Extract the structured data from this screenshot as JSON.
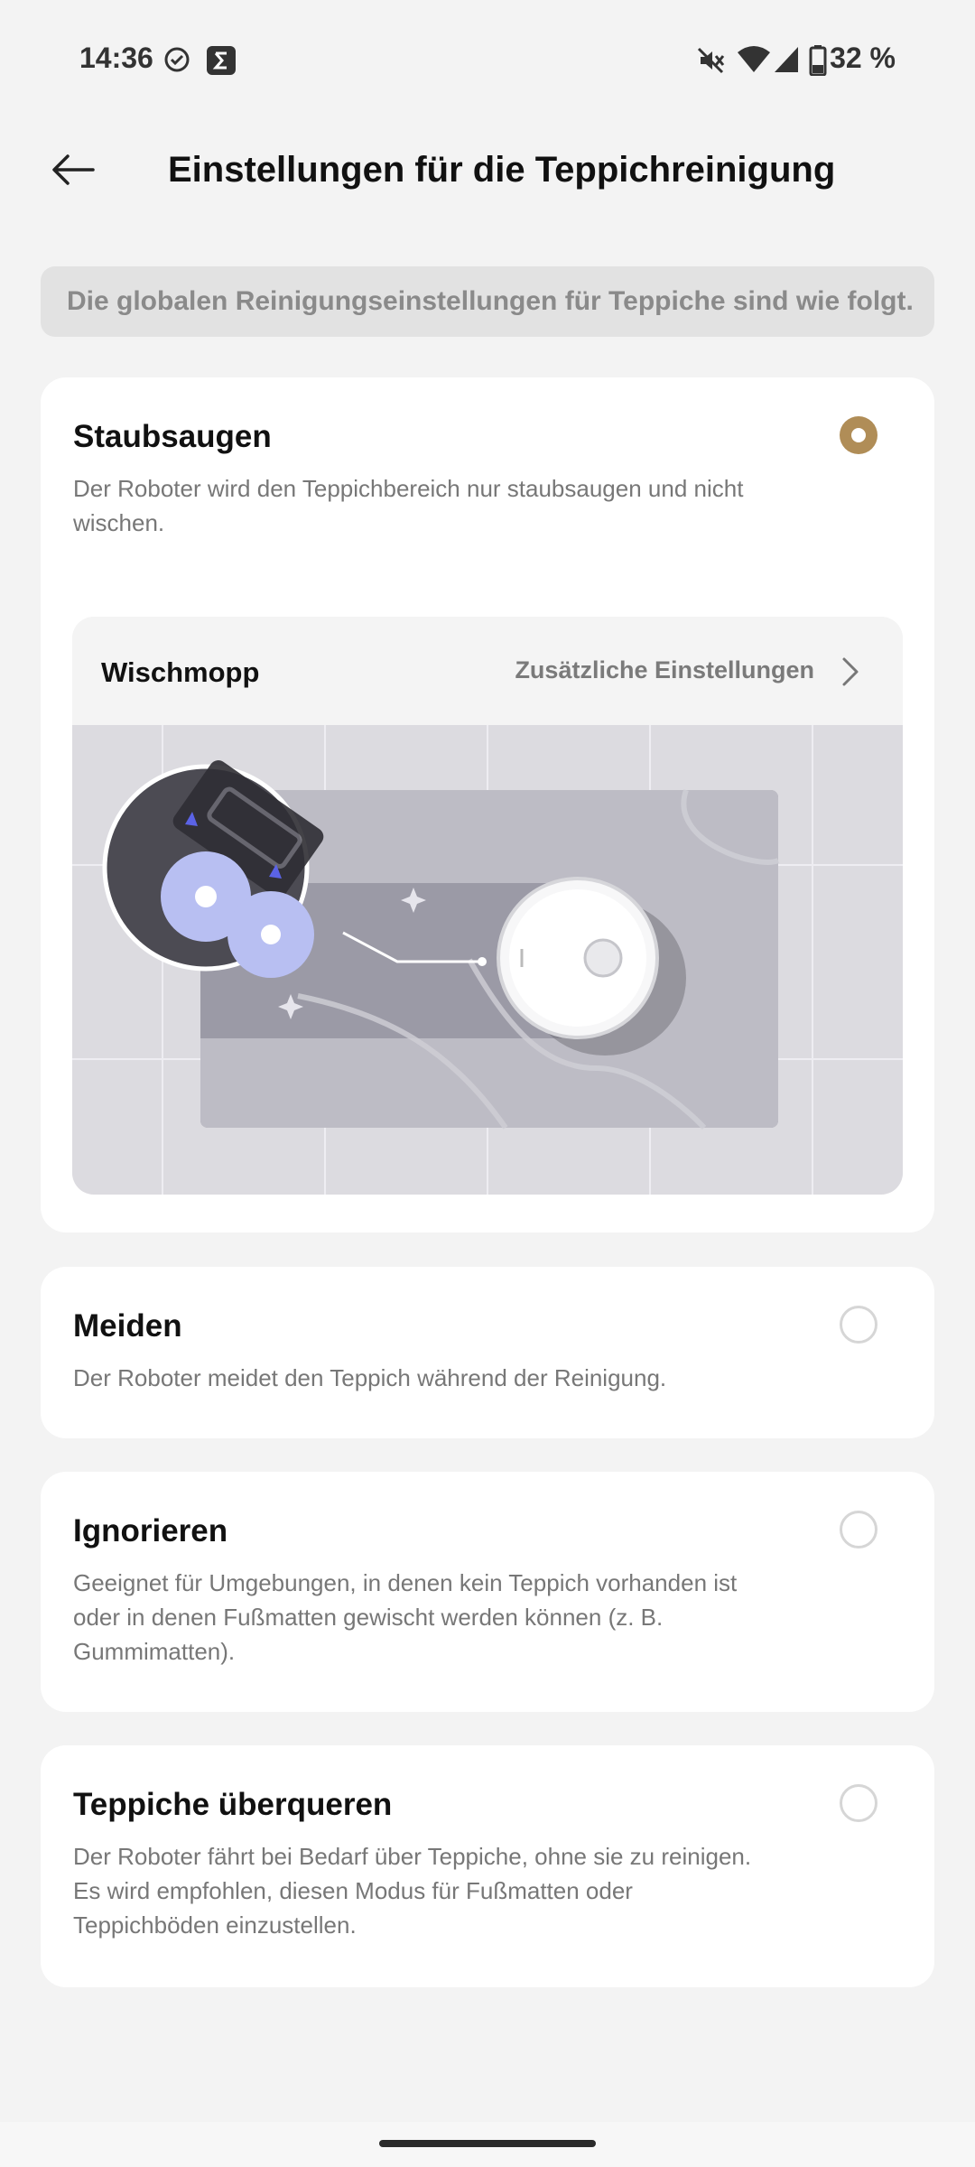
{
  "status_bar": {
    "time": "14:36",
    "battery": "32 %",
    "icons": [
      "check-circle-icon",
      "sigma-app-icon",
      "mute-icon",
      "wifi-icon",
      "cell-signal-icon",
      "battery-icon"
    ]
  },
  "header": {
    "title": "Einstellungen für die Teppichreinigung",
    "back_icon": "back-arrow-icon"
  },
  "info_banner": "Die globalen Reinigungseinstellungen für Teppiche sind wie folgt.",
  "options": [
    {
      "title": "Staubsaugen",
      "description": "Der Roboter wird den Teppichbereich nur staubsaugen und nicht wischen.",
      "selected": true,
      "sub_panel": {
        "title": "Wischmopp",
        "link": "Zusätzliche Einstellungen"
      }
    },
    {
      "title": "Meiden",
      "description": "Der Roboter meidet den Teppich während der Reinigung.",
      "selected": false
    },
    {
      "title": "Ignorieren",
      "description": "Geeignet für Umgebungen, in denen kein Teppich vorhanden ist oder in denen Fußmatten gewischt werden können (z. B. Gummimatten).",
      "selected": false
    },
    {
      "title": "Teppiche überqueren",
      "description": "Der Roboter fährt bei Bedarf über Teppiche, ohne sie zu reinigen. Es wird empfohlen, diesen Modus für Fußmatten oder Teppichböden einzustellen.",
      "selected": false
    }
  ],
  "colors": {
    "accent": "#b08d57",
    "background": "#f3f3f3",
    "card": "#ffffff",
    "banner": "#e2e2e2"
  }
}
